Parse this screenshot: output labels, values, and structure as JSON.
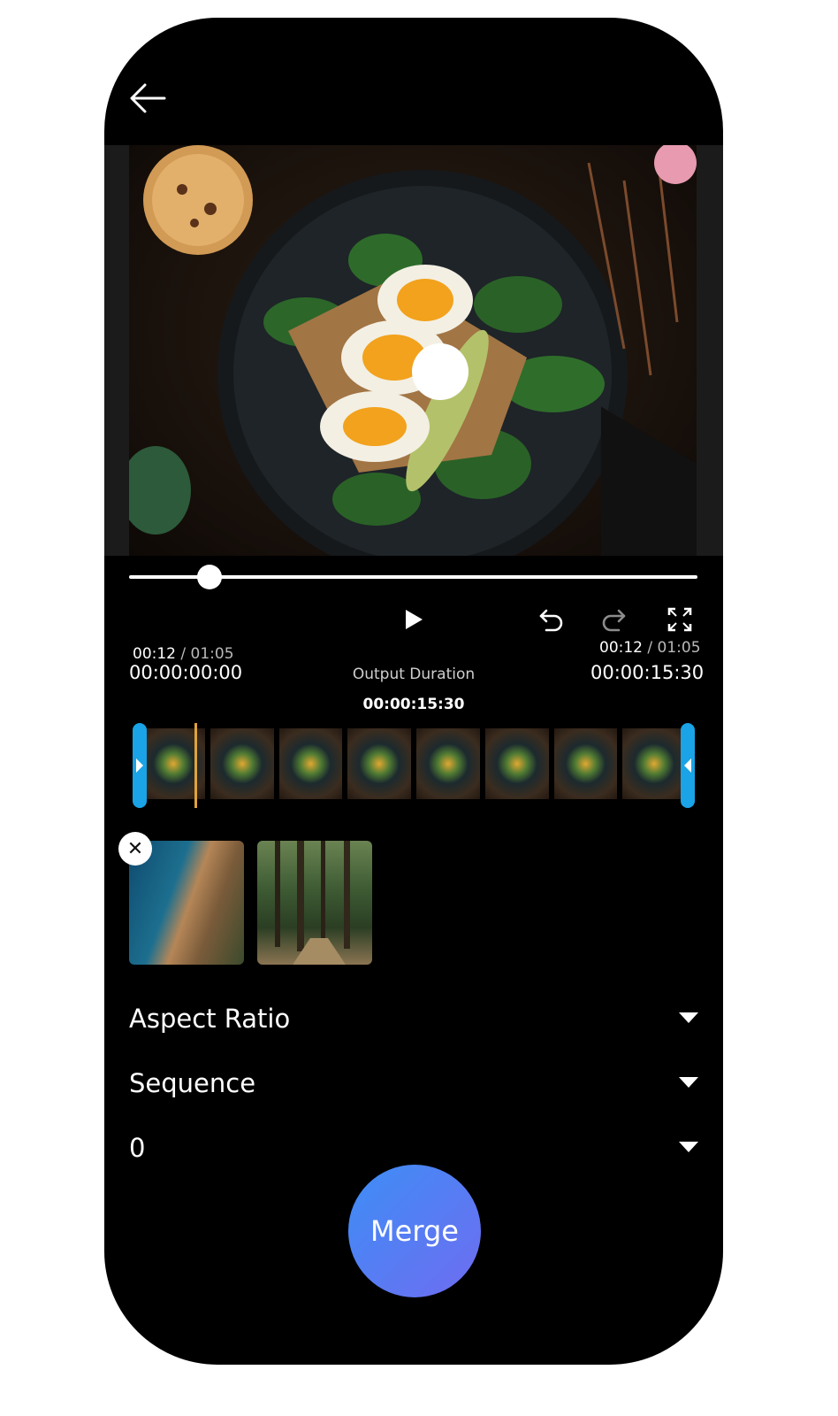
{
  "header": {
    "back_icon": "arrow-left-icon"
  },
  "preview": {
    "time_current_left": "00:12",
    "time_total_left": "01:05",
    "time_current_right": "00:12",
    "time_total_right": "01:05",
    "play_icon": "play-icon",
    "progress": 0.15
  },
  "controls": {
    "play_icon": "play-icon",
    "undo_icon": "undo-icon",
    "redo_icon": "redo-icon",
    "fullscreen_icon": "fullscreen-icon"
  },
  "timeline": {
    "start_time": "00:00:00:00",
    "end_time": "00:00:15:30",
    "output_label": "Output Duration",
    "output_value": "00:00:15:30"
  },
  "clips": {
    "remove_icon": "close-icon"
  },
  "options": {
    "aspect_ratio_label": "Aspect Ratio",
    "sequence_label": "Sequence",
    "third_value": "0"
  },
  "actions": {
    "merge_label": "Merge"
  },
  "colors": {
    "accent_blue": "#1aa3e6",
    "playhead": "#e0a43a",
    "merge_start": "#3d8ef6",
    "merge_end": "#6f6cf0"
  }
}
